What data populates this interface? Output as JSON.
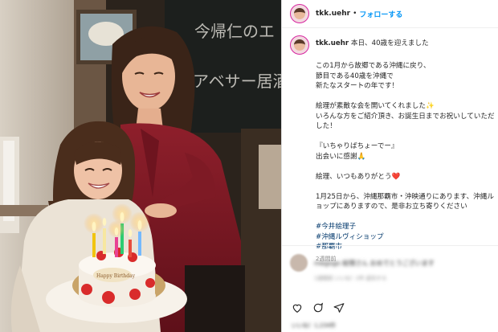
{
  "post": {
    "username": "tkk.uehr",
    "separator": "•",
    "follow_label": "フォローする",
    "caption_first": "本日、40歳を迎えました",
    "caption_lines": [
      "この1月から故郷である沖縄に戻り、",
      "節目である40歳を沖縄で",
      "新たなスタートの年です！",
      "",
      "絵理が素敵な会を開いてくれました✨",
      "いろんな方をご紹介頂き、お誕生日までお祝いしていただ",
      "した！",
      "",
      "『いちゃりばちょーでー』",
      "出会いに感謝🙏",
      "",
      "絵理、いつもありがとう❤️",
      "",
      "1月25日から、沖縄那覇市・沖映通りにあります、沖縄ル",
      "ョップにありますので、是非お立ち寄りください"
    ],
    "hashtags": [
      "#今井絵理子",
      "#沖縄ルヴィショップ",
      "#那覇市"
    ],
    "time_ago": "2週間前"
  },
  "comment": {
    "text": "megogo 絵理さん おめでとうございます",
    "sub": "1週間前 いいね！2件 返信する"
  },
  "likes_text": "いいね！1,234件",
  "photo": {
    "cake_text": "Happy Birthday",
    "board_text_1": "今帰仁のエ",
    "board_text_2": "アベサー居酒"
  },
  "icons": [
    "heart-icon",
    "comment-icon",
    "share-icon"
  ]
}
